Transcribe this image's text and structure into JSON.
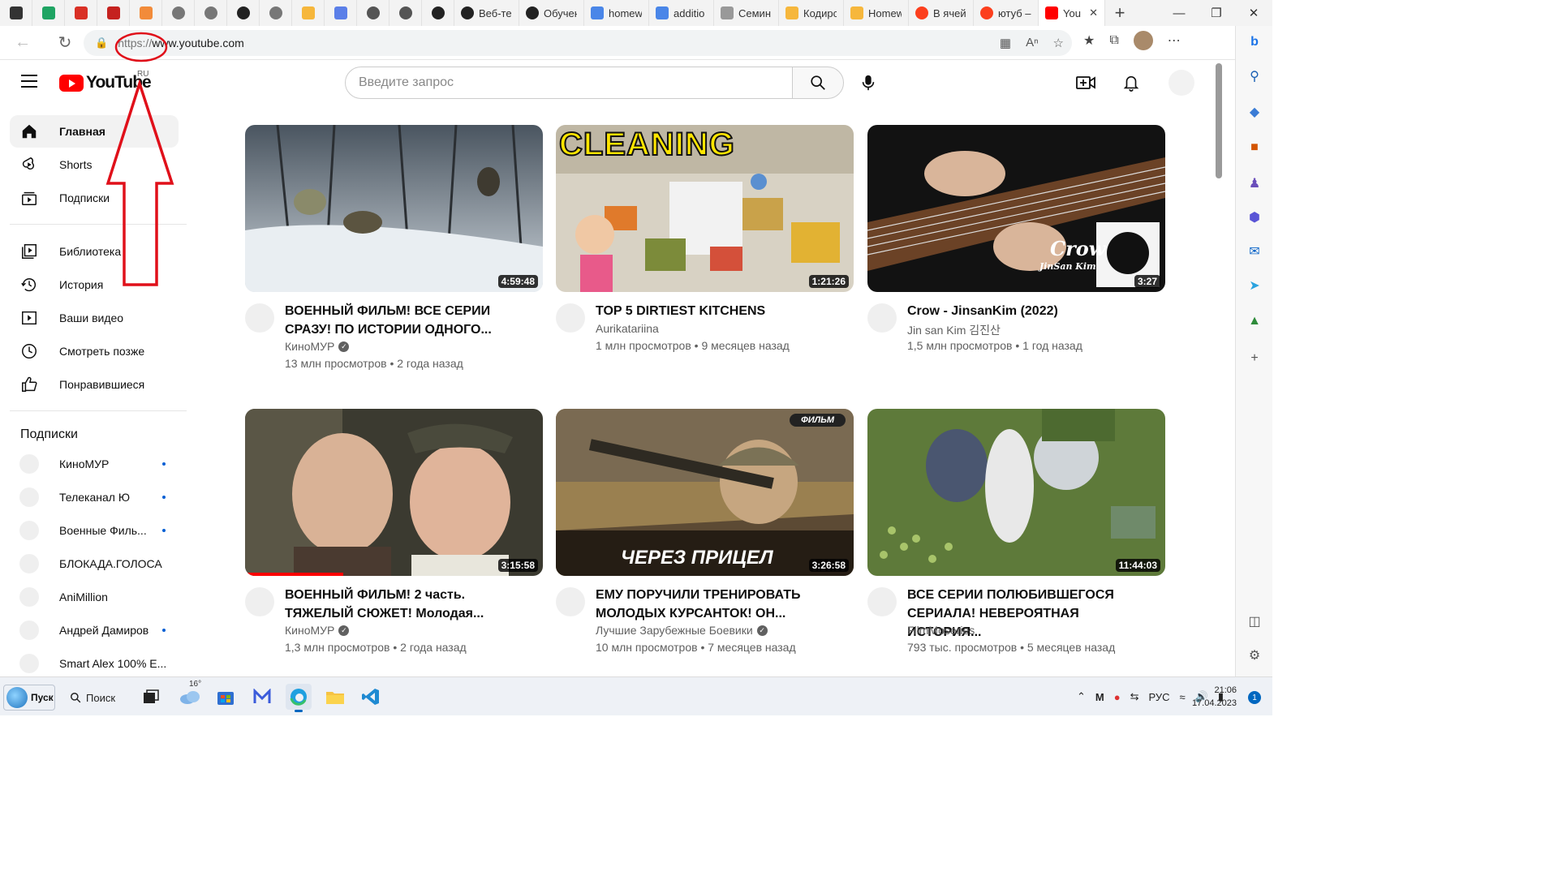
{
  "browser": {
    "tabs": [
      {
        "label": "",
        "icon": "window-icon",
        "color": "#333333"
      },
      {
        "label": "",
        "icon": "drive-icon",
        "color": "#1fa463"
      },
      {
        "label": "",
        "icon": "gmail-icon",
        "color": "#d93025"
      },
      {
        "label": "",
        "icon": "gmail-icon",
        "color": "#c5221f"
      },
      {
        "label": "",
        "icon": "grid-app-icon",
        "color": "#f28b3a"
      },
      {
        "label": "",
        "icon": "openai-icon",
        "color": "#777777"
      },
      {
        "label": "",
        "icon": "openai-icon",
        "color": "#777777"
      },
      {
        "label": "",
        "icon": "openai-icon",
        "color": "#222222"
      },
      {
        "label": "",
        "icon": "openai-icon",
        "color": "#777777"
      },
      {
        "label": "",
        "icon": "infinity-icon",
        "color": "#f6b73c"
      },
      {
        "label": "",
        "icon": "zoom-icon",
        "color": "#5b7fe8"
      },
      {
        "label": "",
        "icon": "github-icon",
        "color": "#555555"
      },
      {
        "label": "",
        "icon": "github-icon",
        "color": "#555555"
      },
      {
        "label": "",
        "icon": "github-icon",
        "color": "#222222"
      },
      {
        "label": "Веб-те",
        "icon": "openai-icon",
        "color": "#222222"
      },
      {
        "label": "Обучен",
        "icon": "openai-icon",
        "color": "#222222"
      },
      {
        "label": "homew",
        "icon": "doc-icon",
        "color": "#4a86e8"
      },
      {
        "label": "additio",
        "icon": "doc-icon",
        "color": "#4a86e8"
      },
      {
        "label": "Семин",
        "icon": "doc-icon",
        "color": "#999999"
      },
      {
        "label": "Кодирс",
        "icon": "infinity-icon",
        "color": "#f6b73c"
      },
      {
        "label": "Homew",
        "icon": "infinity-icon",
        "color": "#f6b73c"
      },
      {
        "label": "В ячей",
        "icon": "yandex-icon",
        "color": "#fc3f1d"
      },
      {
        "label": "ютуб –",
        "icon": "yandex-icon",
        "color": "#fc3f1d"
      },
      {
        "label": "You",
        "icon": "youtube-icon",
        "color": "#ff0000",
        "active": true
      }
    ],
    "new_tab": "+",
    "url_scheme": "https://",
    "url_host": "www.youtube.com"
  },
  "youtube": {
    "logo_text": "YouTube",
    "country": "RU",
    "search_placeholder": "Введите запрос",
    "sidebar": {
      "main": [
        {
          "label": "Главная",
          "icon": "home-icon",
          "active": true
        },
        {
          "label": "Shorts",
          "icon": "shorts-icon"
        },
        {
          "label": "Подписки",
          "icon": "subscriptions-icon"
        }
      ],
      "library": [
        {
          "label": "Библиотека",
          "icon": "library-icon"
        },
        {
          "label": "История",
          "icon": "history-icon"
        },
        {
          "label": "Ваши видео",
          "icon": "your-videos-icon"
        },
        {
          "label": "Смотреть позже",
          "icon": "watch-later-icon"
        },
        {
          "label": "Понравившиеся",
          "icon": "like-icon"
        }
      ],
      "subs_heading": "Подписки",
      "subscriptions": [
        {
          "label": "КиноМУР",
          "new": true
        },
        {
          "label": "Телеканал Ю",
          "new": true
        },
        {
          "label": "Военные Филь...",
          "new": true
        },
        {
          "label": "БЛОКАДА.ГОЛОСА",
          "new": false
        },
        {
          "label": "AniMillion",
          "new": false
        },
        {
          "label": "Андрей Дамиров",
          "new": true
        },
        {
          "label": "Smart Alex 100% E...",
          "new": false
        }
      ]
    },
    "videos": [
      {
        "title": "ВОЕННЫЙ ФИЛЬМ! ВСЕ СЕРИИ СРАЗУ! ПО ИСТОРИИ ОДНОГО...",
        "channel": "КиноМУР",
        "verified": true,
        "views": "13 млн просмотров",
        "age": "2 года назад",
        "duration": "4:59:48",
        "caption": ""
      },
      {
        "title": "TOP 5 DIRTIEST KITCHENS",
        "channel": "Aurikatariina",
        "verified": false,
        "views": "1 млн просмотров",
        "age": "9 месяцев назад",
        "duration": "1:21:26",
        "caption": "CLEANING"
      },
      {
        "title": "Crow - JinsanKim (2022)",
        "channel": "Jin san Kim 김진산",
        "verified": false,
        "views": "1,5 млн просмотров",
        "age": "1 год назад",
        "duration": "3:27",
        "caption": "Crow",
        "caption2": "JinSan Kim"
      },
      {
        "title": "ВОЕННЫЙ ФИЛЬМ! 2 часть. ТЯЖЕЛЫЙ СЮЖЕТ! Молодая...",
        "channel": "КиноМУР",
        "verified": true,
        "views": "1,3 млн просмотров",
        "age": "2 года назад",
        "duration": "3:15:58",
        "caption": "",
        "progress": 0.33
      },
      {
        "title": "ЕМУ ПОРУЧИЛИ ТРЕНИРОВАТЬ МОЛОДЫХ КУРСАНТОК! ОН...",
        "channel": "Лучшие Зарубежные Боевики",
        "verified": true,
        "views": "10 млн просмотров",
        "age": "7 месяцев назад",
        "duration": "3:26:58",
        "caption": "ЧЕРЕЗ ПРИЦЕЛ",
        "badge": "ФИЛЬМ"
      },
      {
        "title": "ВСЕ СЕРИИ ПОЛЮБИВШЕГОСЯ СЕРИАЛА! НЕВЕРОЯТНАЯ ИСТОРИЯ...",
        "channel": "FilmMoseries",
        "verified": false,
        "views": "793 тыс. просмотров",
        "age": "5 месяцев назад",
        "duration": "11:44:03",
        "caption": ""
      }
    ]
  },
  "taskbar": {
    "start_label": "Пуск",
    "search_label": "Поиск",
    "weather_temp": "16°",
    "language": "РУС",
    "time": "21:06",
    "date": "17.04.2023",
    "notifications": "1"
  },
  "colors": {
    "yt_red": "#ff0000",
    "annotation_red": "#e0101a",
    "accent_blue": "#065fd4"
  }
}
